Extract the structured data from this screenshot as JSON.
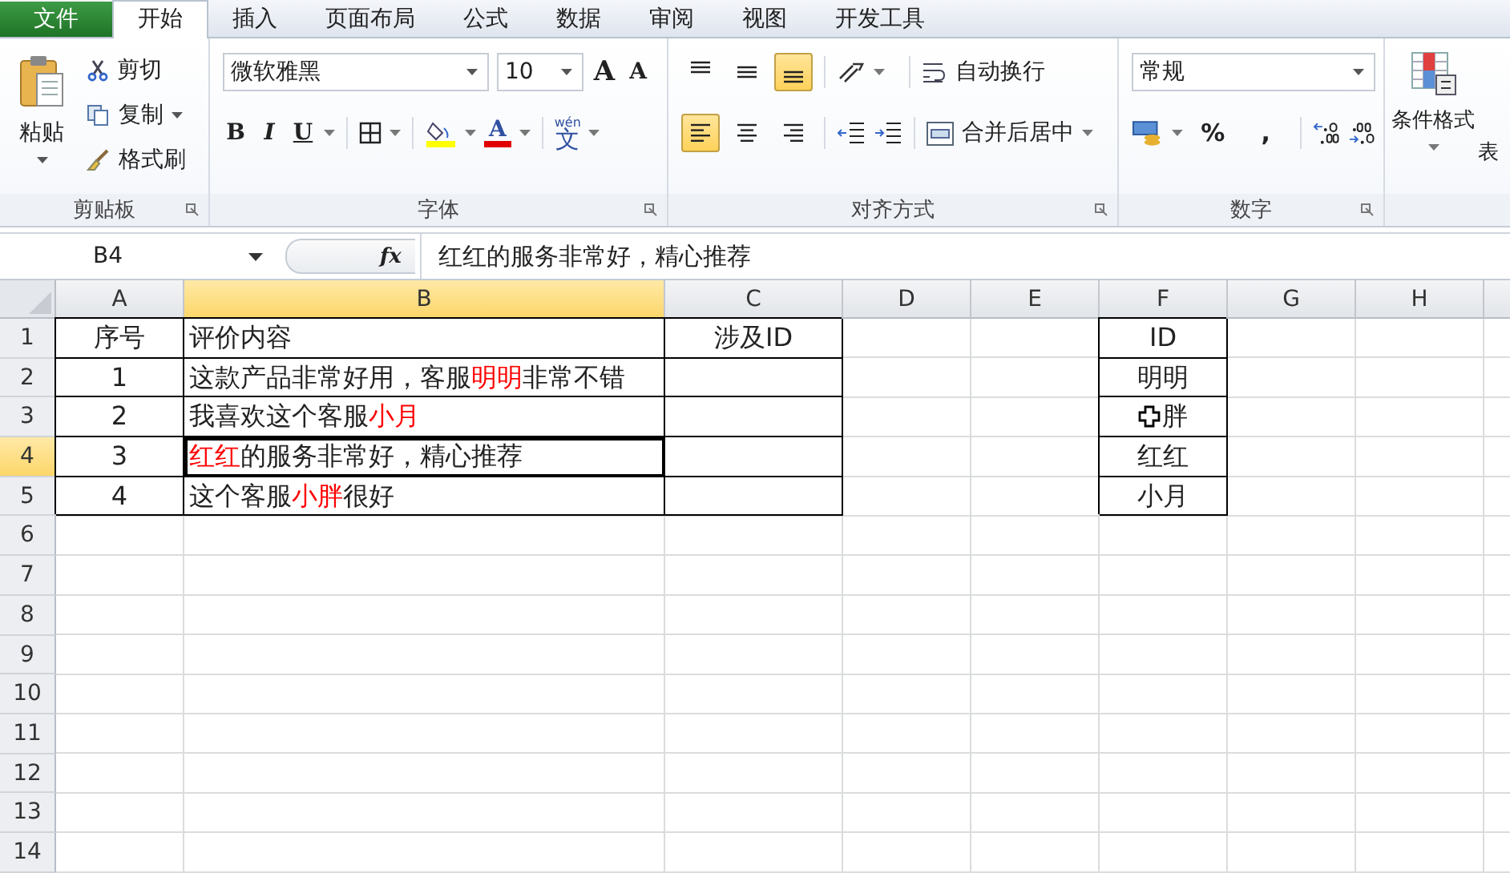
{
  "menu_tabs": [
    {
      "label": "文件",
      "kind": "file",
      "selected": false
    },
    {
      "label": "开始",
      "kind": "tab",
      "selected": true
    },
    {
      "label": "插入",
      "kind": "tab",
      "selected": false
    },
    {
      "label": "页面布局",
      "kind": "tab",
      "selected": false
    },
    {
      "label": "公式",
      "kind": "tab",
      "selected": false
    },
    {
      "label": "数据",
      "kind": "tab",
      "selected": false
    },
    {
      "label": "审阅",
      "kind": "tab",
      "selected": false
    },
    {
      "label": "视图",
      "kind": "tab",
      "selected": false
    },
    {
      "label": "开发工具",
      "kind": "tab",
      "selected": false
    }
  ],
  "clipboard": {
    "title": "剪贴板",
    "paste": "粘贴",
    "cut": "剪切",
    "copy": "复制",
    "format_painter": "格式刷"
  },
  "font": {
    "title": "字体",
    "font_name": "微软雅黑",
    "font_size": "10",
    "grow": "A",
    "shrink": "A",
    "bold": "B",
    "italic": "I",
    "underline": "U",
    "font_color": "A",
    "phonetic": "文",
    "phonetic_hint": "wén"
  },
  "alignment": {
    "title": "对齐方式",
    "wrap_text": "自动换行",
    "merge_center": "合并后居中",
    "vertical": [
      {
        "kind": "top",
        "selected": false
      },
      {
        "kind": "middle",
        "selected": false
      },
      {
        "kind": "bottom",
        "selected": true
      }
    ],
    "horizontal": [
      {
        "kind": "left",
        "selected": true
      },
      {
        "kind": "center",
        "selected": false
      },
      {
        "kind": "right",
        "selected": false
      }
    ]
  },
  "number": {
    "title": "数字",
    "format": "常规",
    "percent": "%",
    "comma": ","
  },
  "styles": {
    "conditional_format": "条件格式",
    "table_format": "表"
  },
  "formula_bar": {
    "name_box": "B4",
    "function_label": "fx",
    "formula": "红红的服务非常好，精心推荐"
  },
  "columns": [
    {
      "label": "A",
      "selected": false
    },
    {
      "label": "B",
      "selected": true
    },
    {
      "label": "C",
      "selected": false
    },
    {
      "label": "D",
      "selected": false
    },
    {
      "label": "E",
      "selected": false
    },
    {
      "label": "F",
      "selected": false
    },
    {
      "label": "G",
      "selected": false
    },
    {
      "label": "H",
      "selected": false
    }
  ],
  "rows": [
    {
      "header": "1",
      "selected": false,
      "bordered": true,
      "seq": "序号",
      "review": {
        "selected": false,
        "segments": [
          {
            "text": "评价内容",
            "highlight": false
          }
        ]
      },
      "involved": "涉及ID",
      "id": {
        "pointer": false,
        "text": "ID"
      }
    },
    {
      "header": "2",
      "selected": false,
      "bordered": true,
      "seq": "1",
      "review": {
        "selected": false,
        "segments": [
          {
            "text": "这款产品非常好用，客服",
            "highlight": false
          },
          {
            "text": "明明",
            "highlight": true
          },
          {
            "text": "非常不错",
            "highlight": false
          }
        ]
      },
      "id": {
        "pointer": false,
        "text": "明明"
      }
    },
    {
      "header": "3",
      "selected": false,
      "bordered": true,
      "seq": "2",
      "review": {
        "selected": false,
        "segments": [
          {
            "text": "我喜欢这个客服",
            "highlight": false
          },
          {
            "text": "小月",
            "highlight": true
          }
        ]
      },
      "id": {
        "pointer": true,
        "text": "胖"
      }
    },
    {
      "header": "4",
      "selected": true,
      "bordered": true,
      "seq": "3",
      "review": {
        "selected": true,
        "segments": [
          {
            "text": "红红",
            "highlight": true
          },
          {
            "text": "的服务非常好，精心推荐",
            "highlight": false
          }
        ]
      },
      "id": {
        "pointer": false,
        "text": "红红"
      }
    },
    {
      "header": "5",
      "selected": false,
      "bordered": true,
      "seq": "4",
      "review": {
        "selected": false,
        "segments": [
          {
            "text": "这个客服",
            "highlight": false
          },
          {
            "text": "小胖",
            "highlight": true
          },
          {
            "text": "很好",
            "highlight": false
          }
        ]
      },
      "id": {
        "pointer": false,
        "text": "小月"
      }
    },
    {
      "header": "6",
      "selected": false,
      "bordered": false
    },
    {
      "header": "7",
      "selected": false,
      "bordered": false
    },
    {
      "header": "8",
      "selected": false,
      "bordered": false
    },
    {
      "header": "9",
      "selected": false,
      "bordered": false
    },
    {
      "header": "10",
      "selected": false,
      "bordered": false
    },
    {
      "header": "11",
      "selected": false,
      "bordered": false
    },
    {
      "header": "12",
      "selected": false,
      "bordered": false
    },
    {
      "header": "13",
      "selected": false,
      "bordered": false
    },
    {
      "header": "14",
      "selected": false,
      "bordered": false
    }
  ]
}
